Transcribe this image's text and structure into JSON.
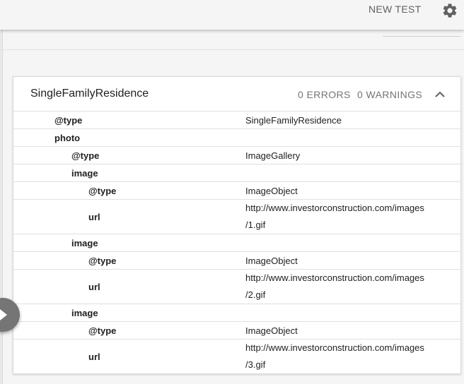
{
  "toolbar": {
    "new_test_label": "NEW TEST",
    "settings_icon": "gear-icon"
  },
  "card": {
    "title": "SingleFamilyResidence",
    "errors": "0 ERRORS",
    "warnings": "0 WARNINGS",
    "collapse_icon": "chevron-up-icon"
  },
  "rows": [
    {
      "key": "@type",
      "value": "SingleFamilyResidence",
      "level": 1
    },
    {
      "key": "photo",
      "value": "",
      "level": 1
    },
    {
      "key": "@type",
      "value": "ImageGallery",
      "level": 2
    },
    {
      "key": "image",
      "value": "",
      "level": 2
    },
    {
      "key": "@type",
      "value": "ImageObject",
      "level": 3
    },
    {
      "key": "url",
      "value": "http://www.investorconstruction.com/images/1.gif",
      "level": 3
    },
    {
      "key": "image",
      "value": "",
      "level": 2
    },
    {
      "key": "@type",
      "value": "ImageObject",
      "level": 3
    },
    {
      "key": "url",
      "value": "http://www.investorconstruction.com/images/2.gif",
      "level": 3
    },
    {
      "key": "image",
      "value": "",
      "level": 2
    },
    {
      "key": "@type",
      "value": "ImageObject",
      "level": 3
    },
    {
      "key": "url",
      "value": "http://www.investorconstruction.com/images/3.gif",
      "level": 3
    }
  ],
  "colors": {
    "background": "#f5f5f5",
    "card": "#ffffff",
    "muted_text": "#757575",
    "fab": "#757575"
  }
}
